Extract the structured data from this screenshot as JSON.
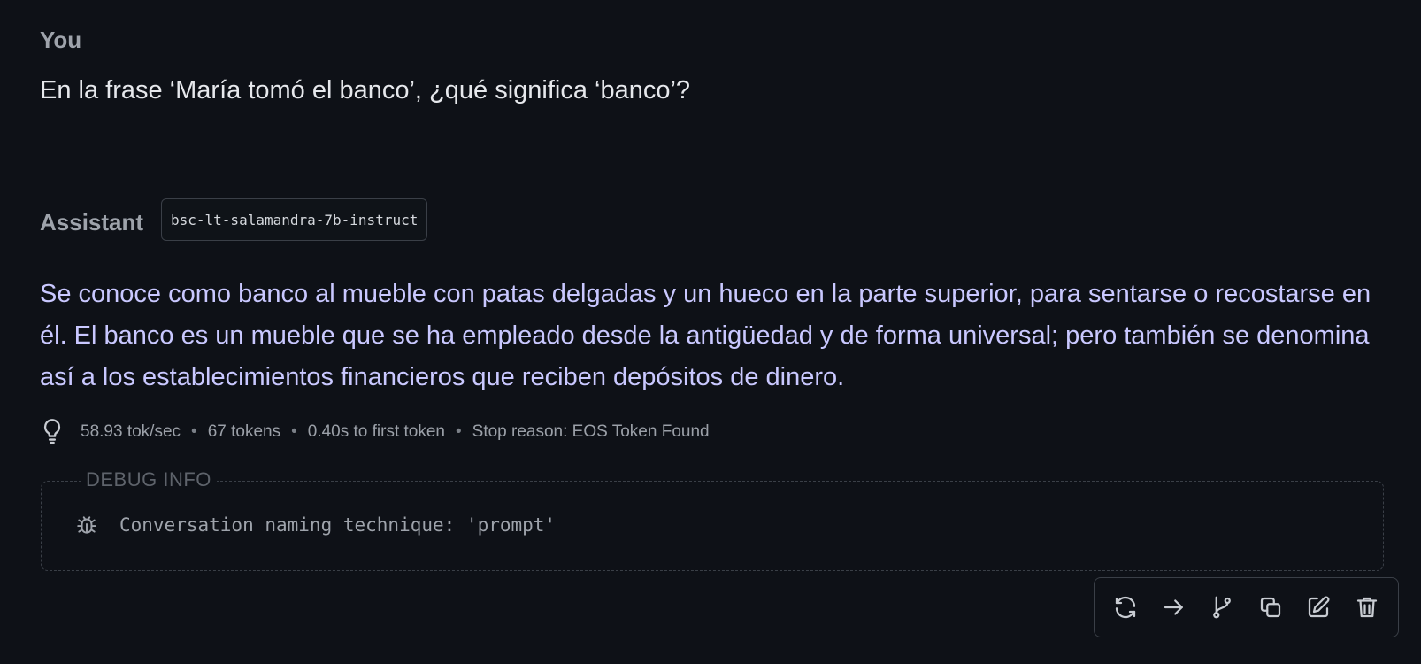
{
  "conversation": {
    "user": {
      "label": "You",
      "message": "En la frase ‘María tomó el banco’, ¿qué significa ‘banco’?"
    },
    "assistant": {
      "label": "Assistant",
      "model": "bsc-lt-salamandra-7b-instruct",
      "message": "Se conoce como banco al mueble con patas delgadas y un hueco en la parte superior, para sentarse o recostarse en él. El banco es un mueble que se ha empleado desde la antigüedad y de forma universal; pero también se denomina así a los establecimientos financieros que reciben depósitos de dinero."
    }
  },
  "stats": {
    "icon": "lightbulb-icon",
    "tok_per_sec": "58.93 tok/sec",
    "tokens": "67 tokens",
    "first_token": "0.40s to first token",
    "stop_reason": "Stop reason: EOS Token Found",
    "separator": "•"
  },
  "debug": {
    "title": "DEBUG INFO",
    "icon": "bug-icon",
    "text": "Conversation naming technique: 'prompt'"
  },
  "toolbar": {
    "buttons": [
      "regenerate-icon",
      "continue-icon",
      "branch-icon",
      "copy-icon",
      "edit-icon",
      "delete-icon"
    ]
  },
  "colors": {
    "background": "#0e1117",
    "assistant_text": "#c9c8ff",
    "user_text": "#e6e8ec",
    "muted": "#9ea3ab",
    "border": "#3a3f47"
  }
}
